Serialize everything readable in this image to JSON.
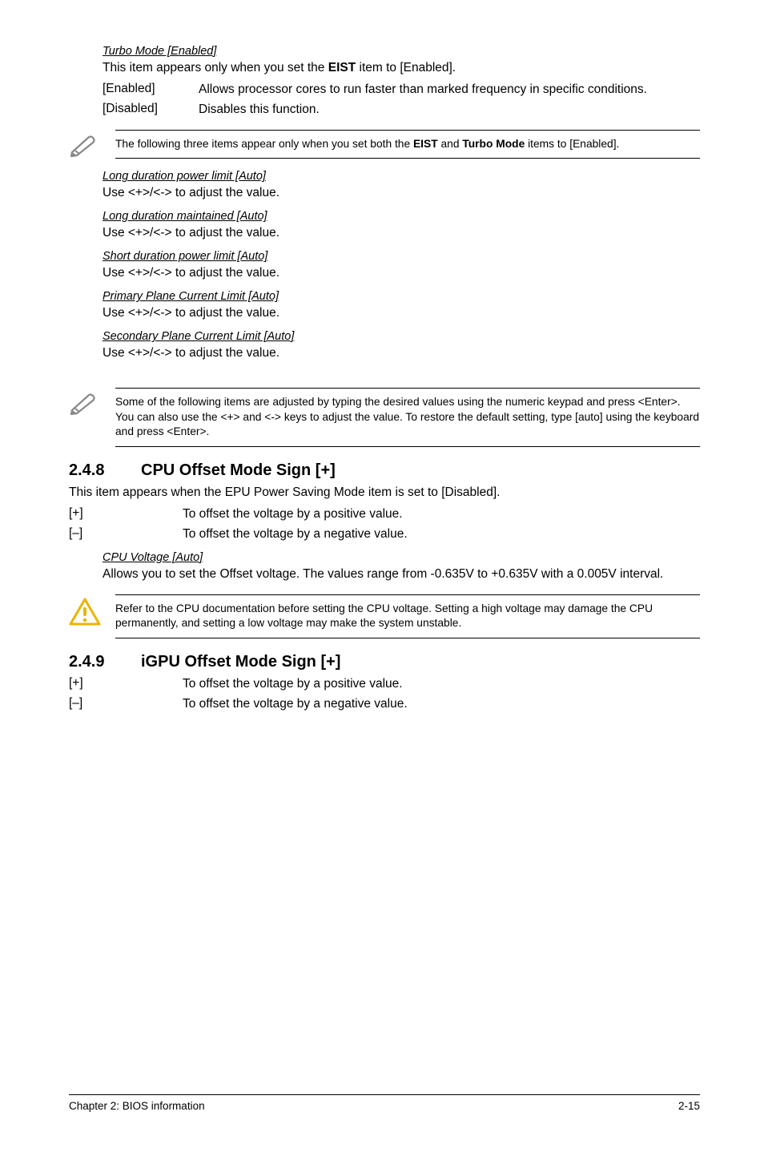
{
  "turbo": {
    "title": "Turbo Mode [Enabled]",
    "desc_prefix": "This item appears only when you set the ",
    "desc_bold": "EIST",
    "desc_suffix": " item to [Enabled].",
    "enabled_label": "[Enabled]",
    "enabled_desc": "Allows processor cores to run faster than marked frequency in specific conditions.",
    "disabled_label": "[Disabled]",
    "disabled_desc": "Disables this function."
  },
  "note1": {
    "prefix": "The following three items appear only when you set both the ",
    "bold1": "EIST",
    "mid": " and ",
    "bold2": "Turbo Mode",
    "suffix": " items to [Enabled]."
  },
  "adjust": {
    "long_power": "Long duration power limit [Auto]",
    "use1": "Use <+>/<-> to adjust the value.",
    "long_maint": "Long duration maintained [Auto]",
    "use2": "Use <+>/<-> to adjust the value.",
    "short_power": "Short duration power limit [Auto]",
    "use3": "Use <+>/<-> to adjust the value.",
    "primary": "Primary Plane Current Limit [Auto]",
    "use4": "Use <+>/<-> to adjust the value.",
    "secondary": "Secondary Plane Current Limit [Auto]",
    "use5": "Use <+>/<-> to adjust the value."
  },
  "note2": "Some of the following items are adjusted by typing the desired values using the numeric keypad and press <Enter>. You can also use the <+> and <-> keys to adjust the value. To restore the default setting, type [auto] using the keyboard and press <Enter>.",
  "s248": {
    "num": "2.4.8",
    "title": "CPU Offset Mode Sign [+]",
    "intro": "This item appears when the EPU Power Saving Mode item is set to [Disabled].",
    "plus_label": "[+]",
    "plus_desc": "To offset the voltage by a positive value.",
    "minus_label": "[–]",
    "minus_desc": "To offset the voltage by a negative value.",
    "cpu_voltage_title": "CPU Voltage [Auto]",
    "cpu_voltage_desc": "Allows you to set the Offset voltage. The values range from -0.635V to +0.635V with a 0.005V interval."
  },
  "warn": "Refer to the CPU documentation before setting the CPU voltage. Setting a high voltage may damage the CPU permanently, and setting a low voltage may make the system unstable.",
  "s249": {
    "num": "2.4.9",
    "title": "iGPU Offset Mode Sign [+]",
    "plus_label": "[+]",
    "plus_desc": "To offset the voltage by a positive value.",
    "minus_label": "[–]",
    "minus_desc": "To offset the voltage by a negative value."
  },
  "footer": {
    "left": "Chapter 2: BIOS information",
    "right": "2-15"
  }
}
